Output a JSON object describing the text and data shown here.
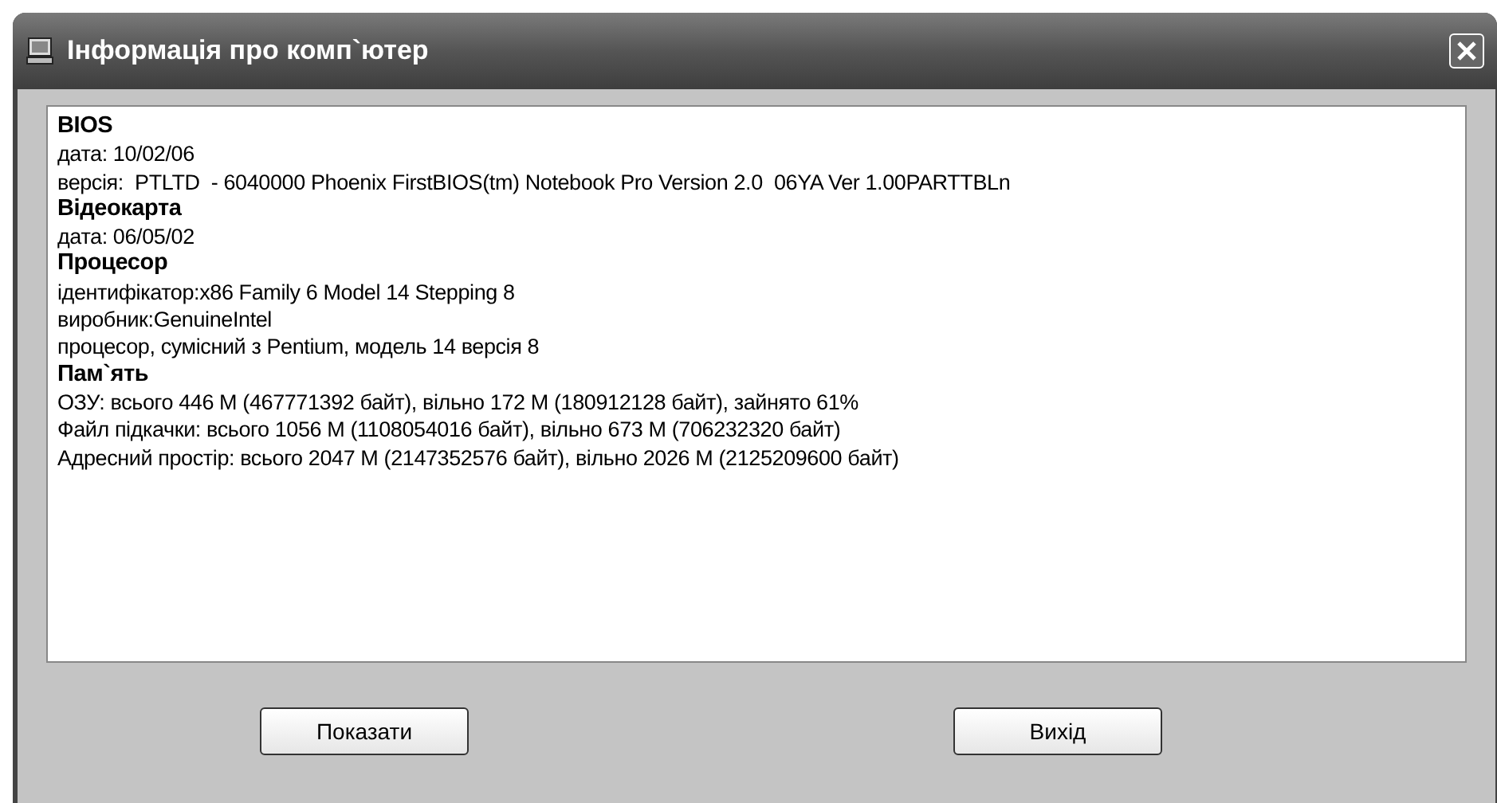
{
  "window": {
    "title": "Інформація про комп`ютер"
  },
  "info": [
    {
      "heading": "BIOS",
      "lines": [
        "дата: 10/02/06",
        "версія:  PTLTD  - 6040000 Phoenix FirstBIOS(tm) Notebook Pro Version 2.0  06YA Ver 1.00PARTTBLn"
      ]
    },
    {
      "heading": "Відеокарта",
      "lines": [
        "дата: 06/05/02"
      ]
    },
    {
      "heading": "Процесор",
      "lines": [
        "ідентифікатор:x86 Family 6 Model 14 Stepping 8",
        "виробник:GenuineIntel",
        "процесор, сумісний з Pentium, модель 14 версія 8"
      ]
    },
    {
      "heading": "Пам`ять",
      "lines": [
        "ОЗУ: всього 446 М (467771392 байт), вільно 172 М (180912128 байт), зайнято 61%",
        "Файл підкачки: всього 1056 М (1108054016 байт), вільно 673 М (706232320 байт)",
        "Адресний простір: всього 2047 М (2147352576 байт), вільно 2026 М (2125209600 байт)"
      ]
    }
  ],
  "buttons": [
    "Показати",
    "Вихід"
  ]
}
